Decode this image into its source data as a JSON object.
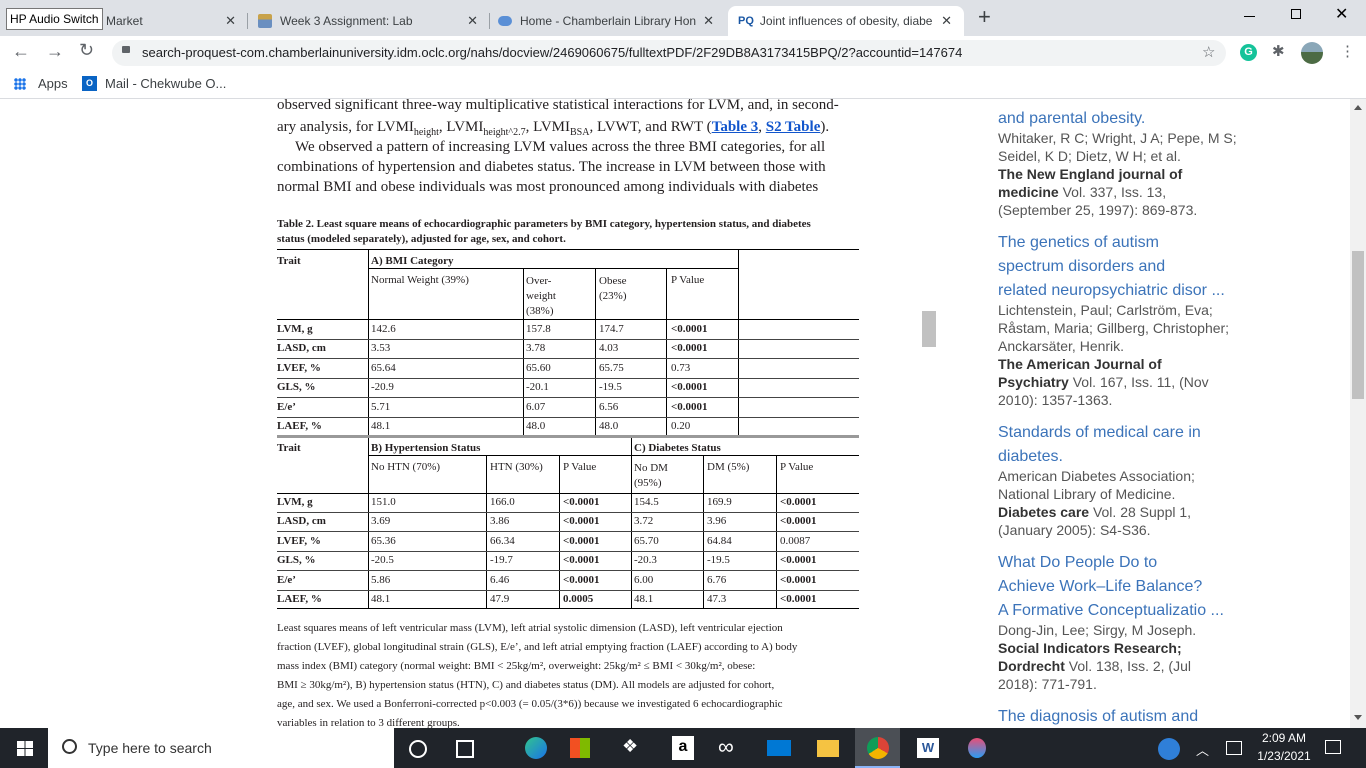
{
  "tabs": [
    {
      "label": "HP Audio Switch",
      "title": "Market"
    },
    {
      "title": "Week 3 Assignment: Lab"
    },
    {
      "title": "Home - Chamberlain Library Hon"
    },
    {
      "title": "Joint influences of obesity, diabe",
      "icon": "PQ"
    }
  ],
  "address": {
    "url": "search-proquest-com.chamberlainuniversity.idm.oclc.org/nahs/docview/2469060675/fulltextPDF/2F29DB8A3173415BPQ/2?accountid=147674"
  },
  "bookmarks": [
    {
      "label": "Apps"
    },
    {
      "label": "Mail - Chekwube O..."
    }
  ],
  "pdf": {
    "line1": "observed significant three-way multiplicative statistical interactions for LVM, and, in second-",
    "line2_pre": "ary analysis, for LVMI",
    "line2_sub1": "height",
    "line2_mid1": ", LVMI",
    "line2_sub2": "height^2.7",
    "line2_mid2": ", LVMI",
    "line2_sub3": "BSA",
    "line2_mid3": ", LVWT, and RWT (",
    "link1": "Table 3",
    "line2_comma": ", ",
    "link2": "S2 Table",
    "line2_end": ").",
    "para2": [
      "We observed a pattern of increasing LVM values across the three BMI categories, for all",
      "combinations of hypertension and diabetes status. The increase in LVM between those with",
      "normal BMI and obese individuals was most pronounced among individuals with diabetes"
    ],
    "table_caption": [
      "Table 2.  Least square means of echocardiographic parameters by BMI category, hypertension status, and diabetes",
      "status (modeled separately), adjusted for age, sex, and cohort."
    ],
    "tableA": {
      "trait_header": "Trait",
      "section": "A) BMI Category",
      "cols": [
        "Normal Weight (39%)",
        "Over-\nweight\n(38%)",
        "Obese\n(23%)",
        "P Value"
      ],
      "rows": [
        {
          "trait": "LVM, g",
          "v": [
            "142.6",
            "157.8",
            "174.7",
            "<0.0001"
          ]
        },
        {
          "trait": "LASD, cm",
          "v": [
            "3.53",
            "3.78",
            "4.03",
            "<0.0001"
          ]
        },
        {
          "trait": "LVEF, %",
          "v": [
            "65.64",
            "65.60",
            "65.75",
            "0.73"
          ]
        },
        {
          "trait": "GLS, %",
          "v": [
            "-20.9",
            "-20.1",
            "-19.5",
            "<0.0001"
          ]
        },
        {
          "trait": "E/e’",
          "v": [
            "5.71",
            "6.07",
            "6.56",
            "<0.0001"
          ]
        },
        {
          "trait": "LAEF, %",
          "v": [
            "48.1",
            "48.0",
            "48.0",
            "0.20"
          ]
        }
      ]
    },
    "tableB": {
      "trait_header": "Trait",
      "sectionB": "B) Hypertension Status",
      "sectionC": "C) Diabetes Status",
      "cols": [
        "No HTN (70%)",
        "HTN (30%)",
        "P Value",
        "No DM\n(95%)",
        "DM (5%)",
        "P Value"
      ],
      "rows": [
        {
          "trait": "LVM, g",
          "v": [
            "151.0",
            "166.0",
            "<0.0001",
            "154.5",
            "169.9",
            "<0.0001"
          ]
        },
        {
          "trait": "LASD, cm",
          "v": [
            "3.69",
            "3.86",
            "<0.0001",
            "3.72",
            "3.96",
            "<0.0001"
          ]
        },
        {
          "trait": "LVEF, %",
          "v": [
            "65.36",
            "66.34",
            "<0.0001",
            "65.70",
            "64.84",
            "0.0087"
          ]
        },
        {
          "trait": "GLS, %",
          "v": [
            "-20.5",
            "-19.7",
            "<0.0001",
            "-20.3",
            "-19.5",
            "<0.0001"
          ]
        },
        {
          "trait": "E/e’",
          "v": [
            "5.86",
            "6.46",
            "<0.0001",
            "6.00",
            "6.76",
            "<0.0001"
          ]
        },
        {
          "trait": "LAEF, %",
          "v": [
            "48.1",
            "47.9",
            "0.0005",
            "48.1",
            "47.3",
            "<0.0001"
          ]
        }
      ]
    },
    "footnote": [
      "Least squares means of left ventricular mass (LVM), left atrial systolic dimension (LASD), left ventricular ejection",
      "fraction (LVEF), global longitudinal strain (GLS), E/e’, and left atrial emptying fraction (LAEF) according to A) body",
      "mass index (BMI) category (normal weight: BMI < 25kg/m², overweight: 25kg/m² ≤ BMI < 30kg/m², obese:",
      "BMI ≥ 30kg/m²), B) hypertension status (HTN), C) and diabetes status (DM). All models are adjusted for cohort,",
      "age, and sex. We used a Bonferroni-corrected p<0.003 (= 0.05/(3*6)) because we investigated 6 echocardiographic",
      "variables in relation to 3 different groups."
    ]
  },
  "sidebar": {
    "refs": [
      {
        "title": [
          "and parental obesity."
        ],
        "authors": [
          "Whitaker, R C; Wright, J A; Pepe, M S;",
          "Seidel, K D; Dietz, W H; et al."
        ],
        "source_bold": [
          "The New England journal of",
          "medicine"
        ],
        "source_rest": " Vol. 337, Iss. 13,",
        "date": "(September 25, 1997): 869-873."
      },
      {
        "title": [
          "The genetics of autism",
          "spectrum disorders and",
          "related neuropsychiatric disor ..."
        ],
        "authors": [
          "Lichtenstein, Paul; Carlström, Eva;",
          "Råstam, Maria; Gillberg, Christopher;",
          "Anckarsäter, Henrik."
        ],
        "source_bold": [
          "The American Journal of",
          "Psychiatry"
        ],
        "source_rest": " Vol. 167, Iss. 11,  (Nov",
        "date": "2010): 1357-1363."
      },
      {
        "title": [
          "Standards of medical care in",
          "diabetes."
        ],
        "authors": [
          "American Diabetes Association;",
          "National Library of Medicine."
        ],
        "source_bold": [
          "Diabetes care"
        ],
        "source_rest": " Vol. 28 Suppl 1,",
        "date": "(January 2005): S4-S36."
      },
      {
        "title": [
          "What Do People Do to",
          "Achieve Work–Life Balance?",
          "A Formative Conceptualizatio ..."
        ],
        "authors": [
          "Dong-Jin, Lee; Sirgy, M Joseph."
        ],
        "source_bold": [
          "Social Indicators Research;",
          "Dordrecht"
        ],
        "source_rest": " Vol. 138, Iss. 2,  (Jul",
        "date": "2018): 771-791."
      },
      {
        "title": [
          "The diagnosis of autism and"
        ]
      }
    ]
  },
  "taskbar": {
    "search_placeholder": "Type here to search",
    "time": "2:09 AM",
    "date": "1/23/2021"
  },
  "colors": {
    "tabstrip": "#dee1e6",
    "link": "#3b73b9",
    "taskbar": "#20242a"
  }
}
